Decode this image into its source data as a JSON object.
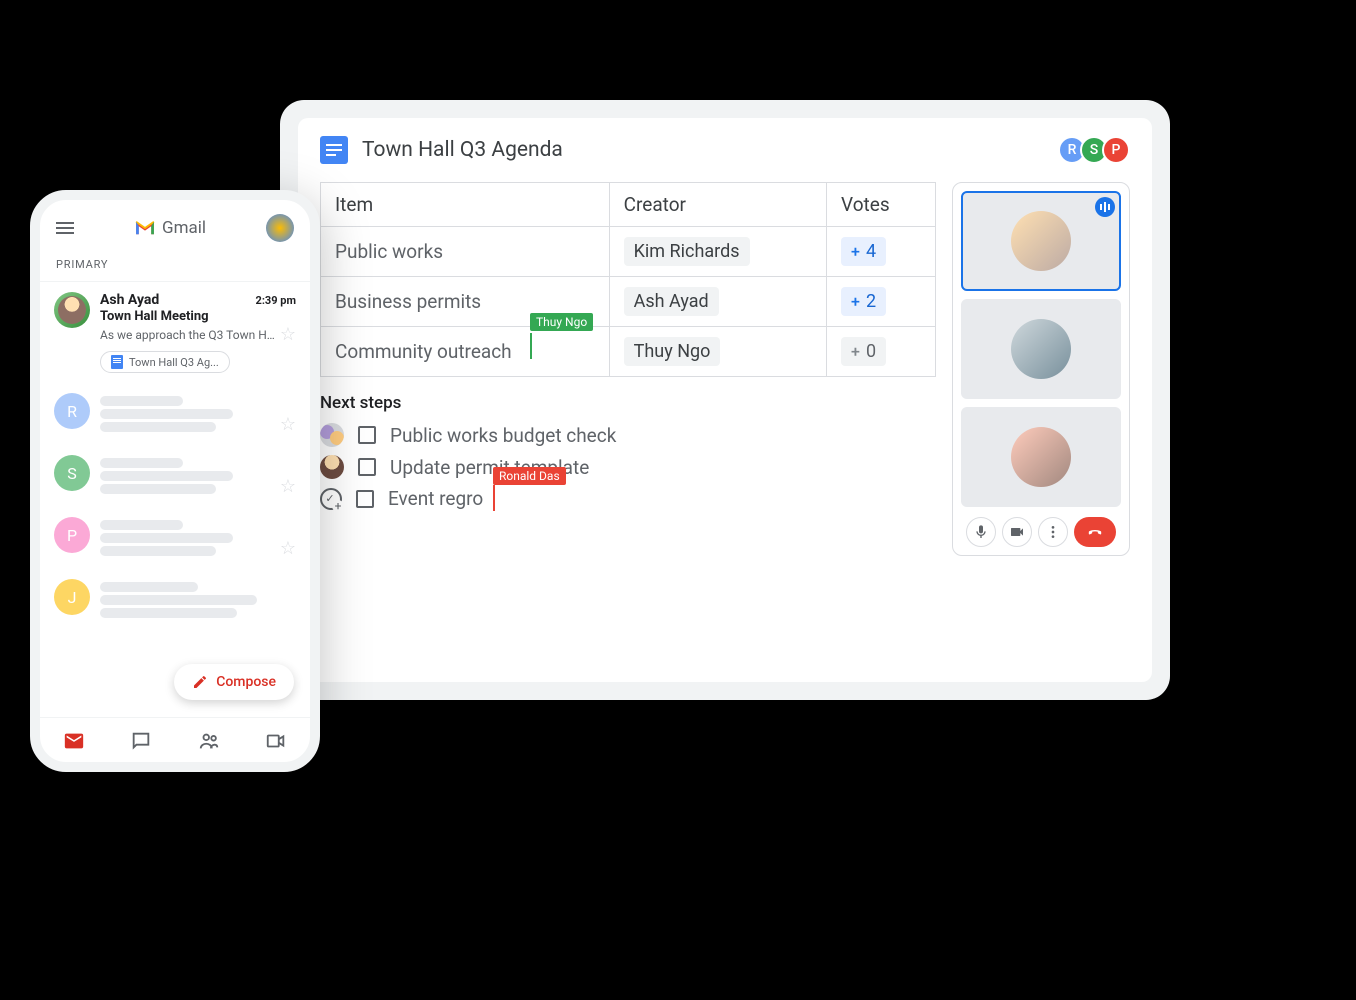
{
  "docs": {
    "title": "Town Hall Q3 Agenda",
    "collaborators": [
      {
        "initial": "R",
        "color": "#669df6"
      },
      {
        "initial": "S",
        "color": "#34a853"
      },
      {
        "initial": "P",
        "color": "#ea4335"
      }
    ],
    "table": {
      "headers": {
        "item": "Item",
        "creator": "Creator",
        "votes": "Votes"
      },
      "rows": [
        {
          "item": "Public works",
          "creator": "Kim Richards",
          "votes": "4"
        },
        {
          "item": "Business permits",
          "creator": "Ash Ayad",
          "votes": "2"
        },
        {
          "item": "Community outreach",
          "creator": "Thuy Ngo",
          "votes": "0"
        }
      ]
    },
    "cursors": {
      "green": "Thuy Ngo",
      "red": "Ronald Das"
    },
    "nextSteps": {
      "heading": "Next steps",
      "items": [
        {
          "text": "Public works budget check"
        },
        {
          "text": "Update permit template"
        },
        {
          "text": "Event regro"
        }
      ]
    }
  },
  "meet": {
    "controls": {
      "mic": "mic",
      "camera": "camera",
      "more": "more",
      "hangup": "hangup"
    }
  },
  "gmail": {
    "appName": "Gmail",
    "primaryLabel": "PRIMARY",
    "compose": "Compose",
    "message": {
      "sender": "Ash Ayad",
      "time": "2:39 pm",
      "subject": "Town Hall Meeting",
      "preview": "As we approach the Q3 Town Ha...",
      "attachment": "Town Hall Q3 Ag..."
    },
    "placeholders": [
      "R",
      "S",
      "P",
      "J"
    ]
  }
}
